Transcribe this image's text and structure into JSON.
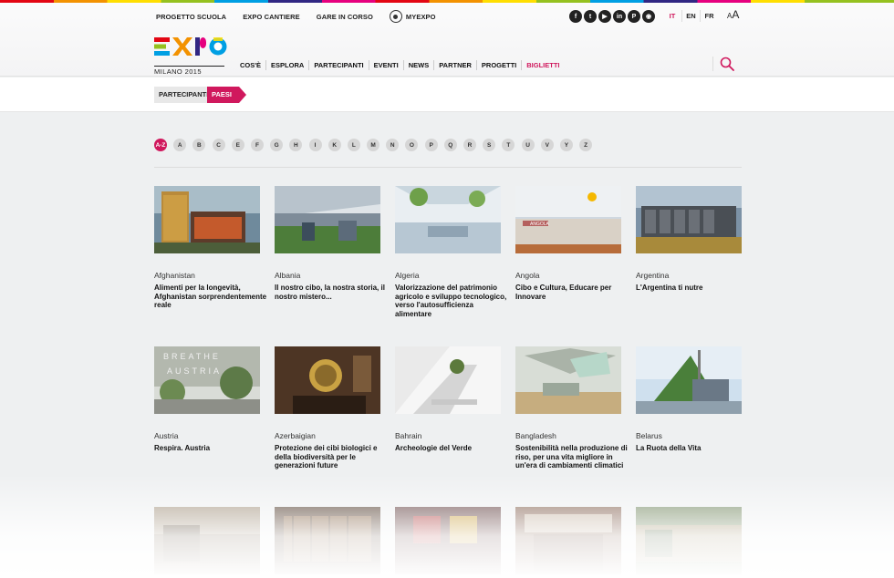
{
  "top_nav": [
    "PROGETTO SCUOLA",
    "EXPO CANTIERE",
    "GARE IN CORSO"
  ],
  "myexpo_label": "MYEXPO",
  "social_icons": [
    "facebook-icon",
    "twitter-icon",
    "youtube-icon",
    "linkedin-icon",
    "pinterest-icon",
    "rss-icon"
  ],
  "languages": [
    "IT",
    "EN",
    "FR"
  ],
  "font_size_control": {
    "small": "A",
    "large": "A"
  },
  "logo": {
    "text": "EXPO",
    "subtitle": "MILANO 2015"
  },
  "main_nav": [
    {
      "label": "COS'È"
    },
    {
      "label": "ESPLORA"
    },
    {
      "label": "PARTECIPANTI",
      "active": true
    },
    {
      "label": "EVENTI"
    },
    {
      "label": "NEWS"
    },
    {
      "label": "PARTNER"
    },
    {
      "label": "PROGETTI"
    },
    {
      "label": "BIGLIETTI",
      "highlight": true
    }
  ],
  "breadcrumb": {
    "parent": "PARTECIPANTI",
    "current": "PAESI"
  },
  "alphabet": [
    "A-Z",
    "A",
    "B",
    "C",
    "E",
    "F",
    "G",
    "H",
    "I",
    "K",
    "L",
    "M",
    "N",
    "O",
    "P",
    "Q",
    "R",
    "S",
    "T",
    "U",
    "V",
    "Y",
    "Z"
  ],
  "alphabet_selected": "A-Z",
  "colors": {
    "accent": "#d0185d"
  },
  "cards": [
    {
      "country": "Afghanistan",
      "title": "Alimenti per la longevità, Afghanistan sorprendentemente reale"
    },
    {
      "country": "Albania",
      "title": "Il nostro cibo, la nostra storia, il nostro mistero..."
    },
    {
      "country": "Algeria",
      "title": "Valorizzazione del patrimonio agricolo e sviluppo tecnologico, verso l'autosufficienza alimentare"
    },
    {
      "country": "Angola",
      "title": "Cibo e Cultura, Educare per Innovare"
    },
    {
      "country": "Argentina",
      "title": "L'Argentina ti nutre"
    },
    {
      "country": "Austria",
      "title": "Respira. Austria"
    },
    {
      "country": "Azerbaigian",
      "title": "Protezione dei cibi biologici e della biodiversità per le generazioni future"
    },
    {
      "country": "Bahrain",
      "title": "Archeologie del Verde"
    },
    {
      "country": "Bangladesh",
      "title": "Sostenibilità nella produzione di riso, per una vita migliore in un'era di cambiamenti climatici"
    },
    {
      "country": "Belarus",
      "title": "La Ruota della Vita"
    }
  ],
  "image_overlays": {
    "angola_sign": "ANGOLA",
    "austria_sign": "AUSTRIA",
    "austria_sign_top": "BREATHE"
  }
}
